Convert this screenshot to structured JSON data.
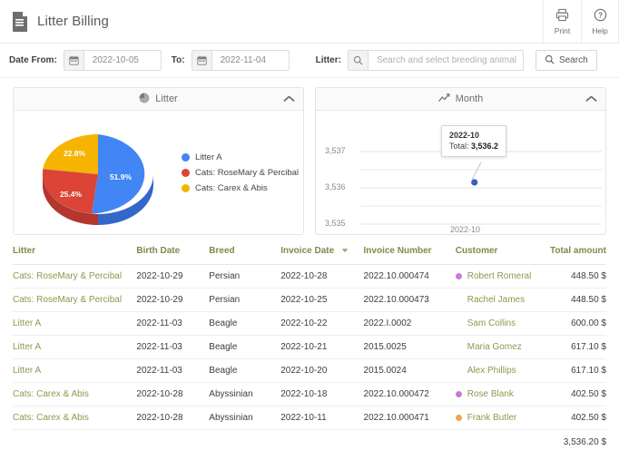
{
  "header": {
    "title": "Litter Billing",
    "doc_icon": "document-icon",
    "actions": [
      {
        "label": "Print",
        "icon": "printer-icon"
      },
      {
        "label": "Help",
        "icon": "help-circle-icon"
      }
    ]
  },
  "filter_bar": {
    "date_from_label": "Date From:",
    "date_from_value": "2022-10-05",
    "to_label": "To:",
    "to_value": "2022-11-04",
    "litter_label": "Litter:",
    "litter_placeholder": "Search and select breeding animal",
    "litter_value": "",
    "search_button": "Search",
    "calendar_icon": "calendar-icon",
    "search_icon": "search-icon"
  },
  "panels": {
    "litter": {
      "title": "Litter",
      "icon": "pie-chart-icon",
      "collapse_icon": "chevron-up-icon"
    },
    "month": {
      "title": "Month",
      "icon": "line-chart-icon",
      "collapse_icon": "chevron-up-icon"
    }
  },
  "colors": {
    "blue": "#4285F4",
    "red": "#DB4437",
    "orange": "#F4B400",
    "blue_dark": "#3367C9",
    "red_dark": "#B5362C",
    "orange_dark": "#C79200",
    "link_green": "#8a9a4e",
    "header_green": "#7e8a4a",
    "dot_purple": "#C77BD6",
    "dot_orange": "#F0A848"
  },
  "chart_data": [
    {
      "type": "pie",
      "title": "Litter",
      "categories": [
        "Litter A",
        "Cats: RoseMary & Percibal",
        "Cats: Carex & Abis"
      ],
      "values": [
        51.9,
        25.4,
        22.8
      ],
      "value_labels": [
        "51.9%",
        "25.4%",
        "22.8%"
      ],
      "colors": [
        "#4285F4",
        "#DB4437",
        "#F4B400"
      ],
      "legend_position": "right",
      "three_d": true
    },
    {
      "type": "line",
      "title": "Month",
      "x": [
        "2022-10"
      ],
      "xlabels": [
        "2022-10"
      ],
      "series": [
        {
          "name": "Total",
          "values": [
            3536.2
          ]
        }
      ],
      "ylim": [
        3535,
        3537
      ],
      "yticks": [
        3535,
        3536,
        3537
      ],
      "ytick_labels": [
        "3,535",
        "3,536",
        "3,537"
      ],
      "gridlines": [
        3535,
        3535.5,
        3536,
        3536.5,
        3537
      ],
      "grid": true,
      "xlabel": "",
      "ylabel": "",
      "point_color": "#3B5FC0",
      "tooltip": {
        "title": "2022-10",
        "label": "Total:",
        "value": "3,536.2"
      }
    }
  ],
  "table": {
    "columns": [
      {
        "key": "litter",
        "label": "Litter",
        "align": "left"
      },
      {
        "key": "birth",
        "label": "Birth Date",
        "align": "left"
      },
      {
        "key": "breed",
        "label": "Breed",
        "align": "left"
      },
      {
        "key": "invdate",
        "label": "Invoice Date",
        "align": "left",
        "sorted": "desc",
        "sort_icon": "caret-down-icon"
      },
      {
        "key": "invnum",
        "label": "Invoice Number",
        "align": "left"
      },
      {
        "key": "customer",
        "label": "Customer",
        "align": "left"
      },
      {
        "key": "total",
        "label": "Total amount",
        "align": "right"
      }
    ],
    "rows": [
      {
        "litter": "Cats: RoseMary & Percibal",
        "birth": "2022-10-29",
        "breed": "Persian",
        "invdate": "2022-10-28",
        "invnum": "2022.10.000474",
        "customer": "Robert Romeral",
        "dot": "#C77BD6",
        "total": "448.50 $"
      },
      {
        "litter": "Cats: RoseMary & Percibal",
        "birth": "2022-10-29",
        "breed": "Persian",
        "invdate": "2022-10-25",
        "invnum": "2022.10.000473",
        "customer": "Rachel James",
        "dot": "",
        "total": "448.50 $"
      },
      {
        "litter": "Litter A",
        "birth": "2022-11-03",
        "breed": "Beagle",
        "invdate": "2022-10-22",
        "invnum": "2022.I.0002",
        "customer": "Sam Collins",
        "dot": "",
        "total": "600.00 $"
      },
      {
        "litter": "Litter A",
        "birth": "2022-11-03",
        "breed": "Beagle",
        "invdate": "2022-10-21",
        "invnum": "2015.0025",
        "customer": "Maria Gomez",
        "dot": "",
        "total": "617.10 $"
      },
      {
        "litter": "Litter A",
        "birth": "2022-11-03",
        "breed": "Beagle",
        "invdate": "2022-10-20",
        "invnum": "2015.0024",
        "customer": "Alex Phillips",
        "dot": "",
        "total": "617.10 $"
      },
      {
        "litter": "Cats: Carex & Abis",
        "birth": "2022-10-28",
        "breed": "Abyssinian",
        "invdate": "2022-10-18",
        "invnum": "2022.10.000472",
        "customer": "Rose Blank",
        "dot": "#C77BD6",
        "total": "402.50 $"
      },
      {
        "litter": "Cats: Carex & Abis",
        "birth": "2022-10-28",
        "breed": "Abyssinian",
        "invdate": "2022-10-11",
        "invnum": "2022.10.000471",
        "customer": "Frank Butler",
        "dot": "#F0A848",
        "total": "402.50 $"
      }
    ],
    "footer_total": "3,536.20 $"
  }
}
